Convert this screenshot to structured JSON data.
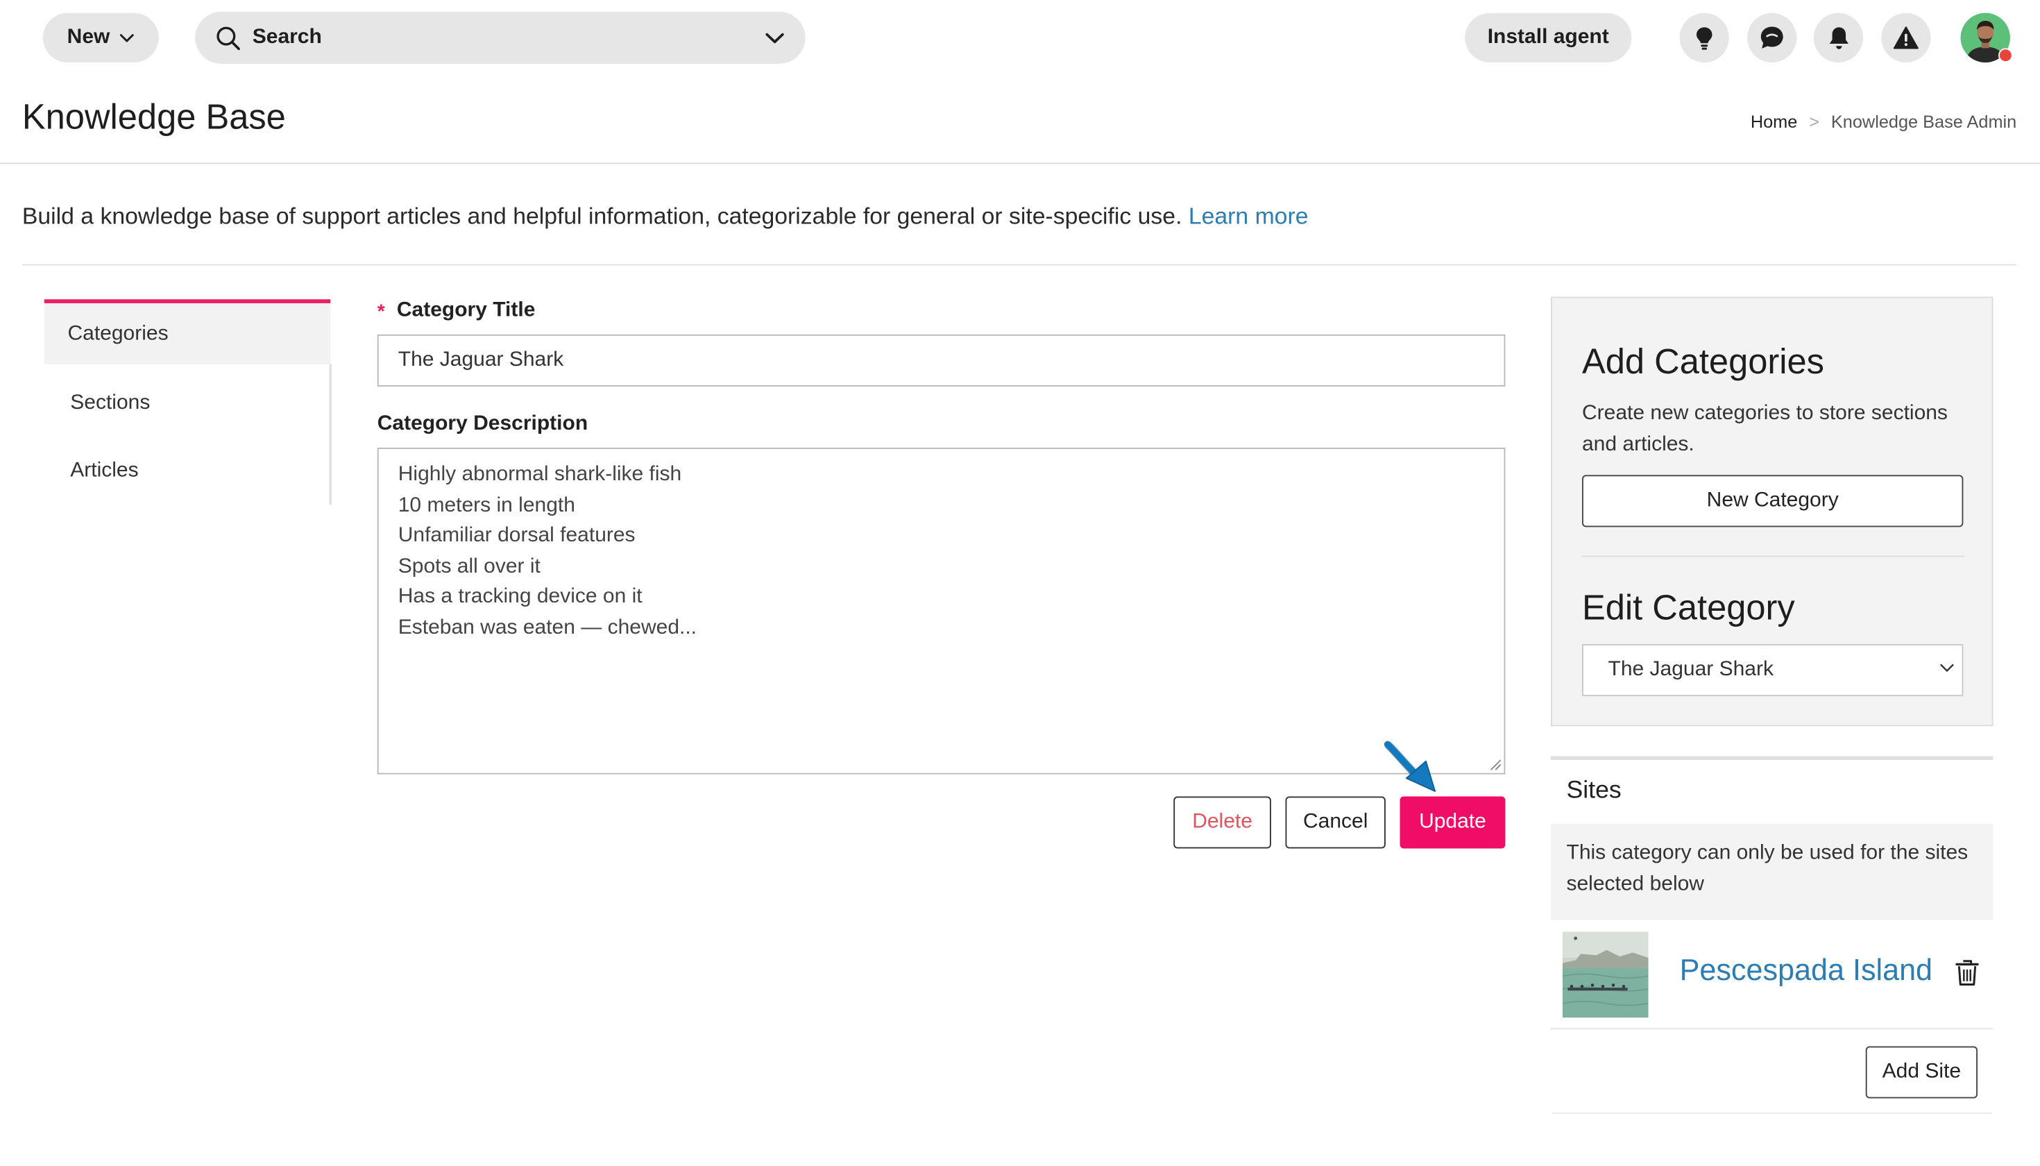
{
  "topbar": {
    "new_label": "New",
    "search_label": "Search",
    "install_label": "Install agent"
  },
  "header": {
    "title": "Knowledge Base",
    "breadcrumb": {
      "home": "Home",
      "sep": ">",
      "current": "Knowledge Base Admin"
    }
  },
  "intro": {
    "text": "Build a knowledge base of support articles and helpful information, categorizable for general or site-specific use.",
    "link": "Learn more"
  },
  "nav": {
    "items": [
      {
        "label": "Categories"
      },
      {
        "label": "Sections"
      },
      {
        "label": "Articles"
      }
    ]
  },
  "form": {
    "required_mark": "*",
    "title_label": "Category Title",
    "title_value": "The Jaguar Shark",
    "desc_label": "Category Description",
    "desc_lines": [
      "Highly abnormal shark-like fish",
      "10 meters in length",
      "Unfamiliar dorsal features",
      "Spots all over it",
      "Has a tracking device on it",
      "Esteban was eaten — chewed..."
    ],
    "delete_label": "Delete",
    "cancel_label": "Cancel",
    "update_label": "Update"
  },
  "add_panel": {
    "heading": "Add Categories",
    "description": "Create new categories to store sections and articles.",
    "new_button": "New Category",
    "edit_heading": "Edit Category",
    "edit_selected": "The Jaguar Shark"
  },
  "sites": {
    "heading": "Sites",
    "note": "This category can only be used for the sites selected below",
    "items": [
      {
        "name": "Pescespada Island"
      }
    ],
    "add_button": "Add Site"
  },
  "colors": {
    "accent": "#ef0d68",
    "link": "#2b7db3",
    "delete_text": "#e0545f",
    "pill_bg": "#e6e6e6",
    "callout_arrow": "#1479bd"
  },
  "icons": {
    "search": "search-icon",
    "chevron": "chevron-down-icon",
    "lightbulb": "lightbulb-icon",
    "chat": "chat-icon",
    "bell": "bell-icon",
    "warning": "warning-icon",
    "trash": "trash-icon",
    "arrow": "callout-arrow-icon"
  }
}
